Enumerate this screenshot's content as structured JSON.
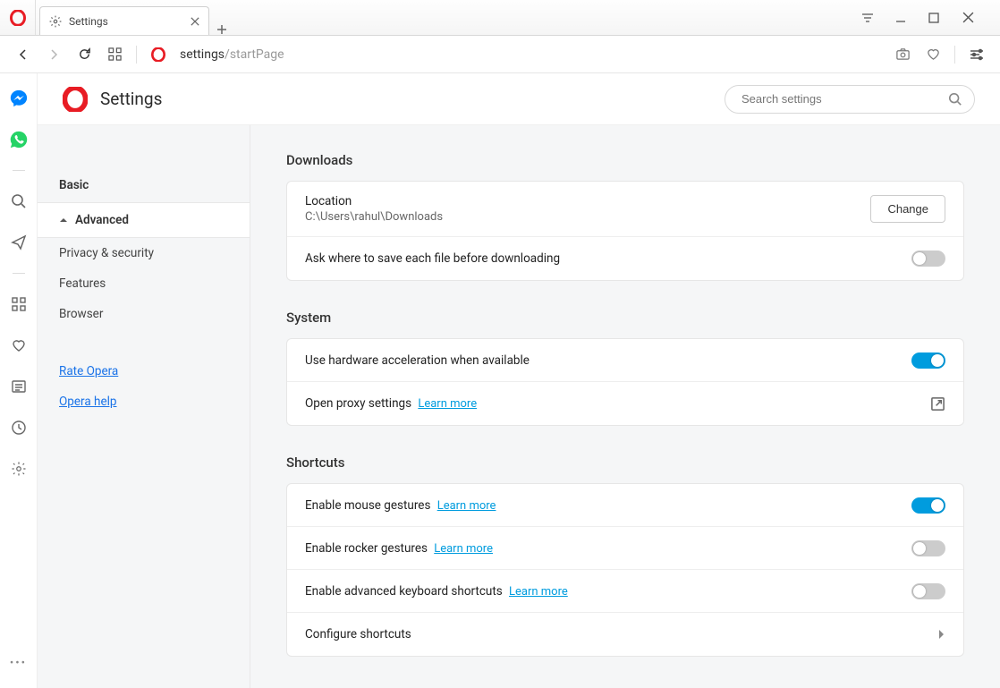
{
  "tab": {
    "title": "Settings"
  },
  "address": {
    "urlBase": "settings",
    "urlPath": "/startPage"
  },
  "header": {
    "title": "Settings",
    "searchPlaceholder": "Search settings"
  },
  "nav": {
    "basic": "Basic",
    "advanced": "Advanced",
    "items": {
      "privacy": "Privacy & security",
      "features": "Features",
      "browser": "Browser"
    },
    "links": {
      "rate": "Rate Opera",
      "help": "Opera help"
    }
  },
  "sections": {
    "downloads": {
      "title": "Downloads",
      "locationLabel": "Location",
      "locationPath": "C:\\Users\\rahul\\Downloads",
      "changeBtn": "Change",
      "askLabel": "Ask where to save each file before downloading"
    },
    "system": {
      "title": "System",
      "hwAccel": "Use hardware acceleration when available",
      "proxyLabel": "Open proxy settings",
      "learnMore": "Learn more"
    },
    "shortcuts": {
      "title": "Shortcuts",
      "mouse": "Enable mouse gestures",
      "rocker": "Enable rocker gestures",
      "keyboard": "Enable advanced keyboard shortcuts",
      "configure": "Configure shortcuts",
      "learnMore": "Learn more"
    }
  }
}
